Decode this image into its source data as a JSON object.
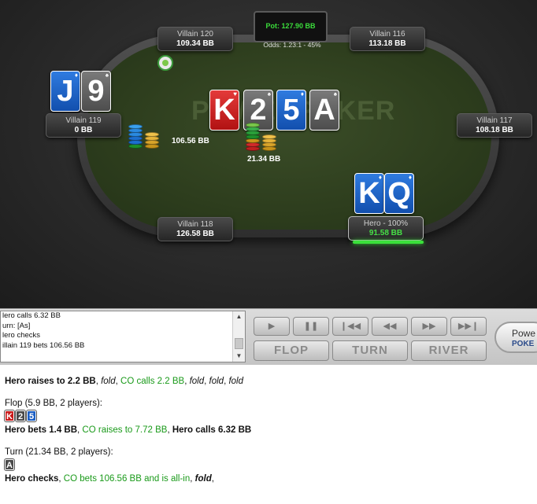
{
  "table": {
    "brand": "POWERPOKER",
    "pot": "Pot: 127.90 BB",
    "odds": "Odds: 1.23:1 - 45%",
    "seats": [
      {
        "name": "Villain 120",
        "stack": "109.34 BB"
      },
      {
        "name": "Villain 116",
        "stack": "113.18 BB"
      },
      {
        "name": "Villain 119",
        "stack": "0 BB"
      },
      {
        "name": "Villain 117",
        "stack": "108.18 BB"
      },
      {
        "name": "Villain 118",
        "stack": "126.58 BB"
      },
      {
        "name": "Hero - 100%",
        "stack": "91.58 BB"
      }
    ],
    "villain119_cards": [
      {
        "rank": "J",
        "color": "blue"
      },
      {
        "rank": "9",
        "color": "gray"
      }
    ],
    "hero_cards": [
      {
        "rank": "K",
        "color": "blue"
      },
      {
        "rank": "Q",
        "color": "blue"
      }
    ],
    "board": [
      {
        "rank": "K",
        "color": "red"
      },
      {
        "rank": "2",
        "color": "gray"
      },
      {
        "rank": "5",
        "color": "blue"
      },
      {
        "rank": "A",
        "color": "gray"
      }
    ],
    "bets": {
      "villain119": "106.56 BB",
      "hero": "21.34 BB"
    }
  },
  "log": {
    "lines": [
      "lero calls 6.32 BB",
      "urn: [As]",
      "lero checks",
      "illain 119 bets 106.56 BB"
    ]
  },
  "controls": {
    "playback": [
      "play-icon",
      "pause-icon",
      "skip-start-icon",
      "rewind-icon",
      "forward-icon",
      "skip-end-icon"
    ],
    "streets": [
      "FLOP",
      "TURN",
      "RIVER"
    ],
    "logo_line1": "Powe",
    "logo_line2": "POKE"
  },
  "history": {
    "preflop": [
      "Hero raises to 2.2 BB",
      ", ",
      "fold",
      ", ",
      "CO calls 2.2 BB",
      ", ",
      "fold",
      ", ",
      "fold",
      ", ",
      "fold"
    ],
    "flop_header": "Flop (5.9 BB, 2 players):",
    "flop_cards": [
      {
        "rank": "K",
        "color": "red"
      },
      {
        "rank": "2",
        "color": "gray"
      },
      {
        "rank": "5",
        "color": "blue"
      }
    ],
    "flop_actions": [
      "Hero bets 1.4 BB",
      ", ",
      "CO raises to 7.72 BB",
      ", ",
      "Hero calls 6.32 BB"
    ],
    "turn_header": "Turn (21.34 BB, 2 players):",
    "turn_cards": [
      {
        "rank": "A",
        "color": "gray"
      }
    ],
    "turn_actions": [
      "Hero checks",
      ", ",
      "CO bets 106.56 BB and is all-in",
      ", ",
      "fold",
      ","
    ]
  },
  "colors": {
    "felt": "#2d3d1d",
    "pot_green": "#3bdc3b",
    "action_green": "#1a9a1a"
  }
}
